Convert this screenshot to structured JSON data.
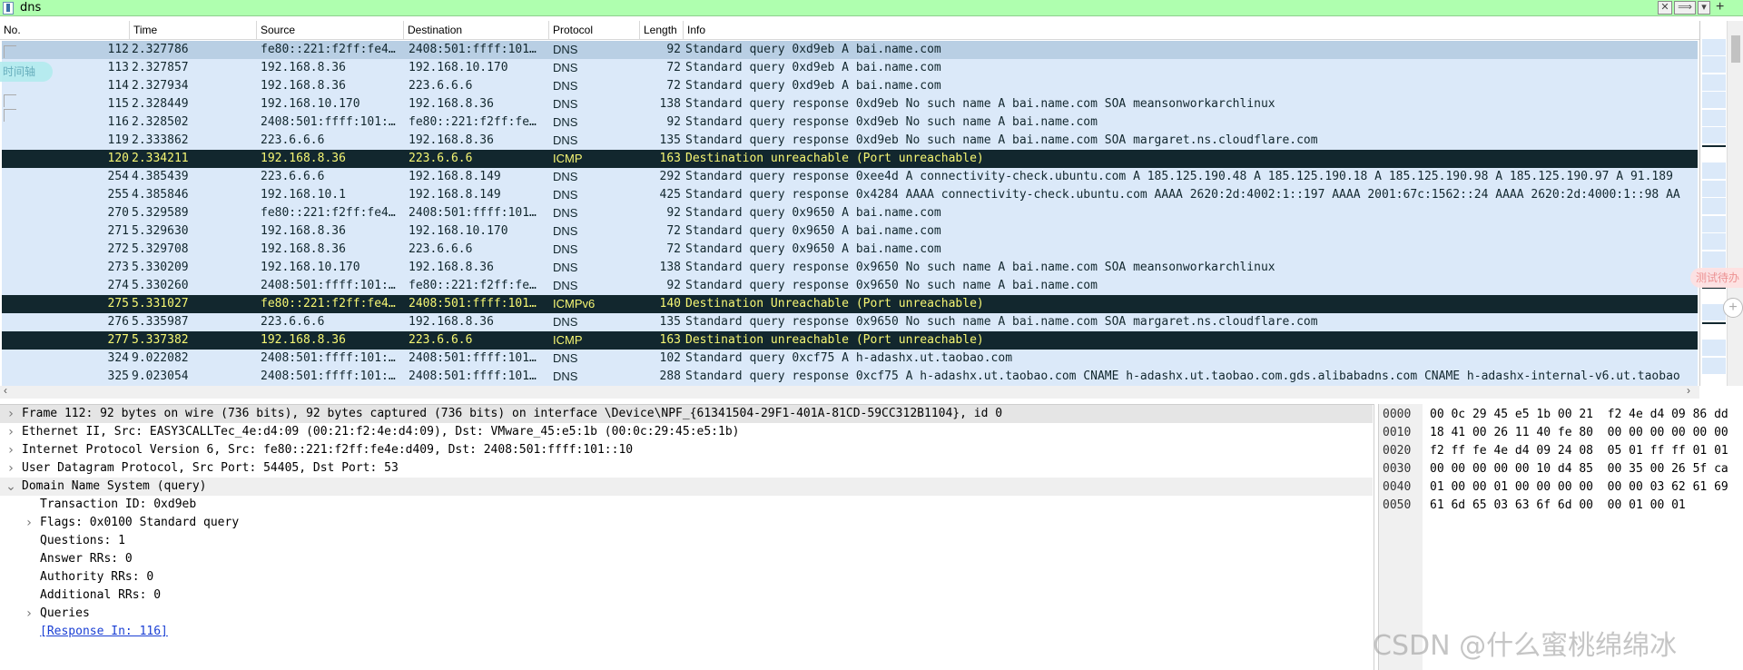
{
  "filter": {
    "text": "dns",
    "clear_glyph": "✕",
    "apply_glyph": "⟹",
    "dropdown_glyph": "▾",
    "add_glyph": "+"
  },
  "columns": [
    "No.",
    "Time",
    "Source",
    "Destination",
    "Protocol",
    "Length",
    "Info"
  ],
  "packets": [
    {
      "no": "112",
      "time": "2.327786",
      "src": "fe80::221:f2ff:fe4…",
      "dst": "2408:501:ffff:101…",
      "proto": "DNS",
      "len": "92",
      "info": "Standard query 0xd9eb A bai.name.com",
      "kind": "selected"
    },
    {
      "no": "113",
      "time": "2.327857",
      "src": "192.168.8.36",
      "dst": "192.168.10.170",
      "proto": "DNS",
      "len": "72",
      "info": "Standard query 0xd9eb A bai.name.com",
      "kind": "dns"
    },
    {
      "no": "114",
      "time": "2.327934",
      "src": "192.168.8.36",
      "dst": "223.6.6.6",
      "proto": "DNS",
      "len": "72",
      "info": "Standard query 0xd9eb A bai.name.com",
      "kind": "dns"
    },
    {
      "no": "115",
      "time": "2.328449",
      "src": "192.168.10.170",
      "dst": "192.168.8.36",
      "proto": "DNS",
      "len": "138",
      "info": "Standard query response 0xd9eb No such name A bai.name.com SOA meansonworkarchlinux",
      "kind": "dns"
    },
    {
      "no": "116",
      "time": "2.328502",
      "src": "2408:501:ffff:101:…",
      "dst": "fe80::221:f2ff:fe…",
      "proto": "DNS",
      "len": "92",
      "info": "Standard query response 0xd9eb No such name A bai.name.com",
      "kind": "dns"
    },
    {
      "no": "119",
      "time": "2.333862",
      "src": "223.6.6.6",
      "dst": "192.168.8.36",
      "proto": "DNS",
      "len": "135",
      "info": "Standard query response 0xd9eb No such name A bai.name.com SOA margaret.ns.cloudflare.com",
      "kind": "dns"
    },
    {
      "no": "120",
      "time": "2.334211",
      "src": "192.168.8.36",
      "dst": "223.6.6.6",
      "proto": "ICMP",
      "len": "163",
      "info": "Destination unreachable (Port unreachable)",
      "kind": "icmp"
    },
    {
      "no": "254",
      "time": "4.385439",
      "src": "223.6.6.6",
      "dst": "192.168.8.149",
      "proto": "DNS",
      "len": "292",
      "info": "Standard query response 0xee4d A connectivity-check.ubuntu.com A 185.125.190.48 A 185.125.190.18 A 185.125.190.98 A 185.125.190.97 A 91.189",
      "kind": "dns"
    },
    {
      "no": "255",
      "time": "4.385846",
      "src": "192.168.10.1",
      "dst": "192.168.8.149",
      "proto": "DNS",
      "len": "425",
      "info": "Standard query response 0x4284 AAAA connectivity-check.ubuntu.com AAAA 2620:2d:4002:1::197 AAAA 2001:67c:1562::24 AAAA 2620:2d:4000:1::98 AA",
      "kind": "dns"
    },
    {
      "no": "270",
      "time": "5.329589",
      "src": "fe80::221:f2ff:fe4…",
      "dst": "2408:501:ffff:101…",
      "proto": "DNS",
      "len": "92",
      "info": "Standard query 0x9650 A bai.name.com",
      "kind": "dns"
    },
    {
      "no": "271",
      "time": "5.329630",
      "src": "192.168.8.36",
      "dst": "192.168.10.170",
      "proto": "DNS",
      "len": "72",
      "info": "Standard query 0x9650 A bai.name.com",
      "kind": "dns"
    },
    {
      "no": "272",
      "time": "5.329708",
      "src": "192.168.8.36",
      "dst": "223.6.6.6",
      "proto": "DNS",
      "len": "72",
      "info": "Standard query 0x9650 A bai.name.com",
      "kind": "dns"
    },
    {
      "no": "273",
      "time": "5.330209",
      "src": "192.168.10.170",
      "dst": "192.168.8.36",
      "proto": "DNS",
      "len": "138",
      "info": "Standard query response 0x9650 No such name A bai.name.com SOA meansonworkarchlinux",
      "kind": "dns"
    },
    {
      "no": "274",
      "time": "5.330260",
      "src": "2408:501:ffff:101:…",
      "dst": "fe80::221:f2ff:fe…",
      "proto": "DNS",
      "len": "92",
      "info": "Standard query response 0x9650 No such name A bai.name.com",
      "kind": "dns"
    },
    {
      "no": "275",
      "time": "5.331027",
      "src": "fe80::221:f2ff:fe4…",
      "dst": "2408:501:ffff:101…",
      "proto": "ICMPv6",
      "len": "140",
      "info": "Destination Unreachable (Port unreachable)",
      "kind": "icmp"
    },
    {
      "no": "276",
      "time": "5.335987",
      "src": "223.6.6.6",
      "dst": "192.168.8.36",
      "proto": "DNS",
      "len": "135",
      "info": "Standard query response 0x9650 No such name A bai.name.com SOA margaret.ns.cloudflare.com",
      "kind": "dns"
    },
    {
      "no": "277",
      "time": "5.337382",
      "src": "192.168.8.36",
      "dst": "223.6.6.6",
      "proto": "ICMP",
      "len": "163",
      "info": "Destination unreachable (Port unreachable)",
      "kind": "icmp"
    },
    {
      "no": "324",
      "time": "9.022082",
      "src": "2408:501:ffff:101:…",
      "dst": "2408:501:ffff:101…",
      "proto": "DNS",
      "len": "102",
      "info": "Standard query 0xcf75 A h-adashx.ut.taobao.com",
      "kind": "dns"
    },
    {
      "no": "325",
      "time": "9.023054",
      "src": "2408:501:ffff:101:…",
      "dst": "2408:501:ffff:101…",
      "proto": "DNS",
      "len": "288",
      "info": "Standard query response 0xcf75 A h-adashx.ut.taobao.com CNAME h-adashx.ut.taobao.com.gds.alibabadns.com CNAME h-adashx-internal-v6.ut.taobao",
      "kind": "dns"
    }
  ],
  "details": [
    {
      "indent": 0,
      "expander": "right",
      "text": "Frame 112: 92 bytes on wire (736 bits), 92 bytes captured (736 bits) on interface \\Device\\NPF_{61341504-29F1-401A-81CD-59CC312B1104}, id 0",
      "style": "sel"
    },
    {
      "indent": 0,
      "expander": "right",
      "text": "Ethernet II, Src: EASY3CALLTec_4e:d4:09 (00:21:f2:4e:d4:09), Dst: VMware_45:e5:1b (00:0c:29:45:e5:1b)",
      "style": ""
    },
    {
      "indent": 0,
      "expander": "right",
      "text": "Internet Protocol Version 6, Src: fe80::221:f2ff:fe4e:d409, Dst: 2408:501:ffff:101::10",
      "style": ""
    },
    {
      "indent": 0,
      "expander": "right",
      "text": "User Datagram Protocol, Src Port: 54405, Dst Port: 53",
      "style": ""
    },
    {
      "indent": 0,
      "expander": "down",
      "text": "Domain Name System (query)",
      "style": "hdr"
    },
    {
      "indent": 1,
      "expander": "none",
      "text": "Transaction ID: 0xd9eb",
      "style": ""
    },
    {
      "indent": 1,
      "expander": "right",
      "text": "Flags: 0x0100 Standard query",
      "style": ""
    },
    {
      "indent": 1,
      "expander": "none",
      "text": "Questions: 1",
      "style": ""
    },
    {
      "indent": 1,
      "expander": "none",
      "text": "Answer RRs: 0",
      "style": ""
    },
    {
      "indent": 1,
      "expander": "none",
      "text": "Authority RRs: 0",
      "style": ""
    },
    {
      "indent": 1,
      "expander": "none",
      "text": "Additional RRs: 0",
      "style": ""
    },
    {
      "indent": 1,
      "expander": "right",
      "text": "Queries",
      "style": ""
    },
    {
      "indent": 1,
      "expander": "none",
      "text": "[Response In: 116]",
      "style": "link"
    }
  ],
  "bytes": [
    {
      "offset": "0000",
      "hex": "00 0c 29 45 e5 1b 00 21  f2 4e d4 09 86 dd"
    },
    {
      "offset": "0010",
      "hex": "18 41 00 26 11 40 fe 80  00 00 00 00 00 00"
    },
    {
      "offset": "0020",
      "hex": "f2 ff fe 4e d4 09 24 08  05 01 ff ff 01 01"
    },
    {
      "offset": "0030",
      "hex": "00 00 00 00 00 10 d4 85  00 35 00 26 5f ca"
    },
    {
      "offset": "0040",
      "hex": "01 00 00 01 00 00 00 00  00 00 03 62 61 69"
    },
    {
      "offset": "0050",
      "hex": "61 6d 65 03 63 6f 6d 00  00 01 00 01"
    }
  ],
  "overlays": {
    "timeline_label": "时间轴",
    "todo_label": "测试待办",
    "plus_glyph": "+"
  },
  "watermark": "CSDN @什么蜜桃绵绵冰",
  "icons": {
    "bookmark": "bookmark-icon",
    "clear": "clear-filter-icon",
    "apply": "apply-filter-icon",
    "dropdown": "filter-history-icon",
    "add": "add-filter-button-icon"
  },
  "colors": {
    "filter_valid": "#afffaf",
    "dns_row": "#dbe9f9",
    "selected_row": "#b9cfe4",
    "icmp_row_bg": "#12272e",
    "icmp_row_fg": "#f7f774",
    "link": "#1a3fd4"
  }
}
